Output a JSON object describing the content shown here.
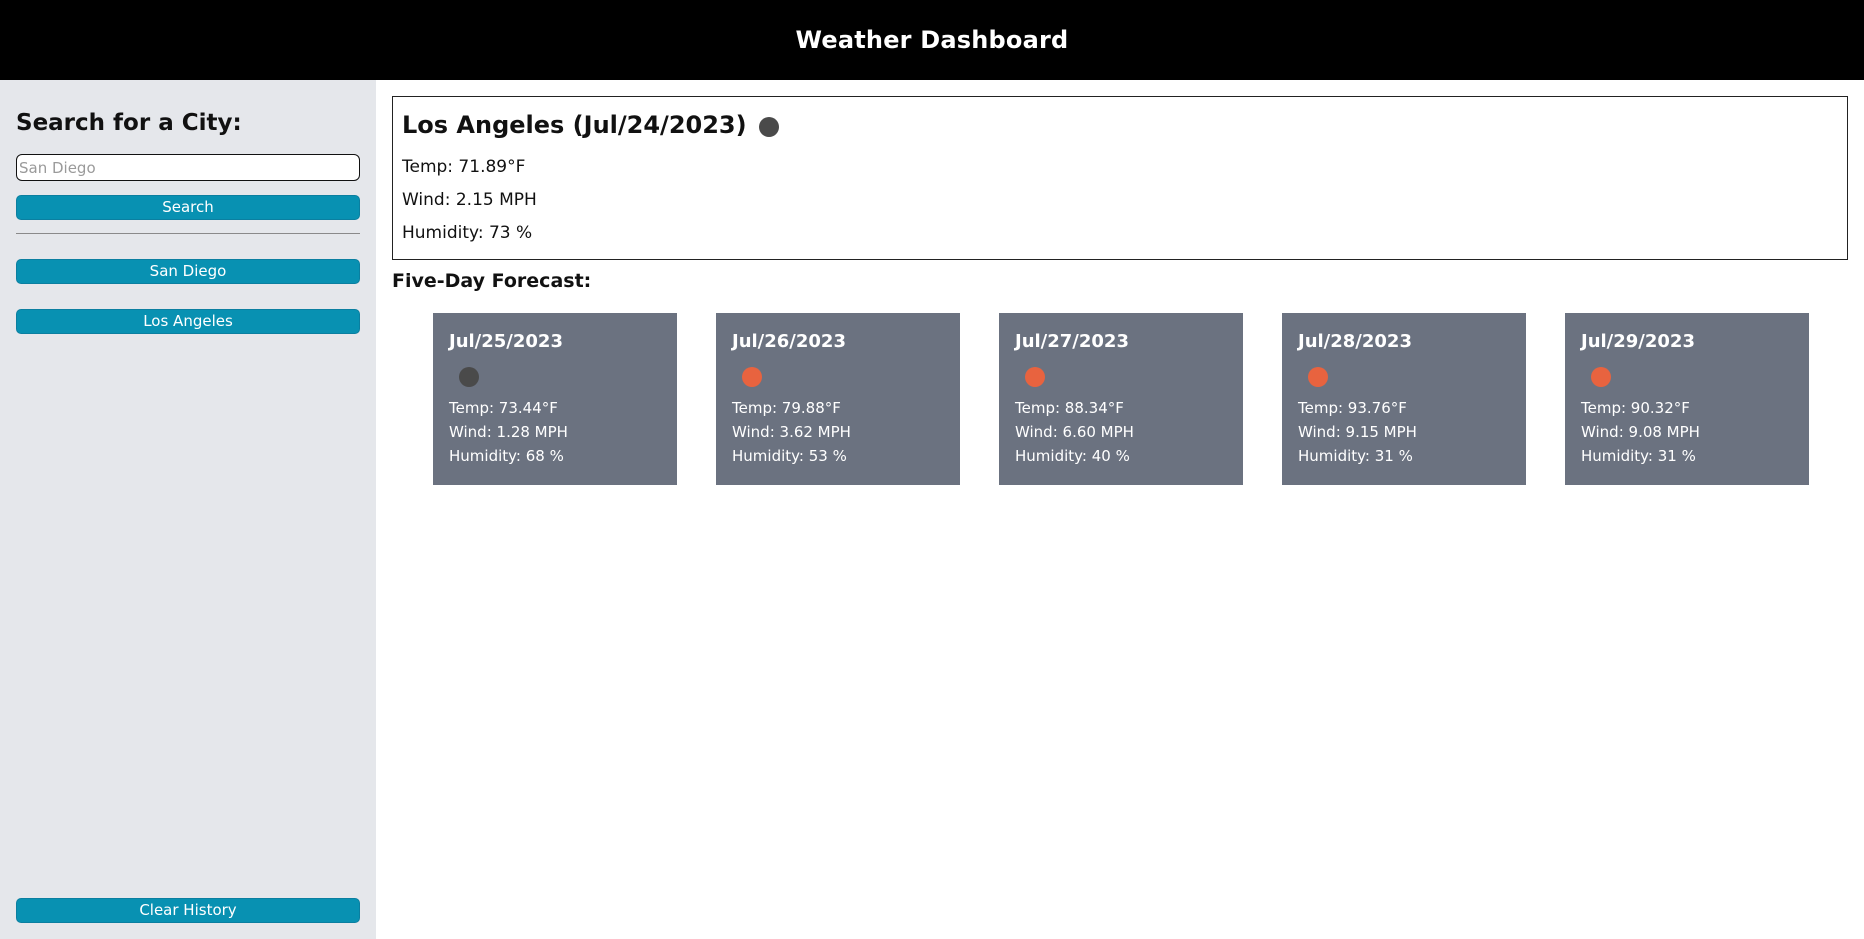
{
  "header": {
    "title": "Weather Dashboard"
  },
  "sidebar": {
    "heading": "Search for a City:",
    "search_input": {
      "value": "",
      "placeholder": "San Diego"
    },
    "search_label": "Search",
    "history": [
      "San Diego",
      "Los Angeles"
    ],
    "clear_label": "Clear History"
  },
  "current": {
    "title": "Los Angeles (Jul/24/2023)",
    "icon": "weather-dot-dark",
    "temp": "Temp: 71.89°F",
    "wind": "Wind: 2.15 MPH",
    "humidity": "Humidity: 73 %"
  },
  "forecast": {
    "heading": "Five-Day Forecast:",
    "days": [
      {
        "date": "Jul/25/2023",
        "icon": "weather-dot-dark",
        "temp": "Temp: 73.44°F",
        "wind": "Wind: 1.28 MPH",
        "humidity": "Humidity: 68 %"
      },
      {
        "date": "Jul/26/2023",
        "icon": "weather-dot-sun",
        "temp": "Temp: 79.88°F",
        "wind": "Wind: 3.62 MPH",
        "humidity": "Humidity: 53 %"
      },
      {
        "date": "Jul/27/2023",
        "icon": "weather-dot-sun",
        "temp": "Temp: 88.34°F",
        "wind": "Wind: 6.60 MPH",
        "humidity": "Humidity: 40 %"
      },
      {
        "date": "Jul/28/2023",
        "icon": "weather-dot-sun",
        "temp": "Temp: 93.76°F",
        "wind": "Wind: 9.15 MPH",
        "humidity": "Humidity: 31 %"
      },
      {
        "date": "Jul/29/2023",
        "icon": "weather-dot-sun",
        "temp": "Temp: 90.32°F",
        "wind": "Wind: 9.08 MPH",
        "humidity": "Humidity: 31 %"
      }
    ]
  },
  "colors": {
    "header_bg": "#000000",
    "sidebar_bg": "#e5e7eb",
    "button_accent": "#0891b2",
    "forecast_card_bg": "#6b7280",
    "icon_dark": "#4a4a4a",
    "icon_sun": "#e8633f"
  }
}
